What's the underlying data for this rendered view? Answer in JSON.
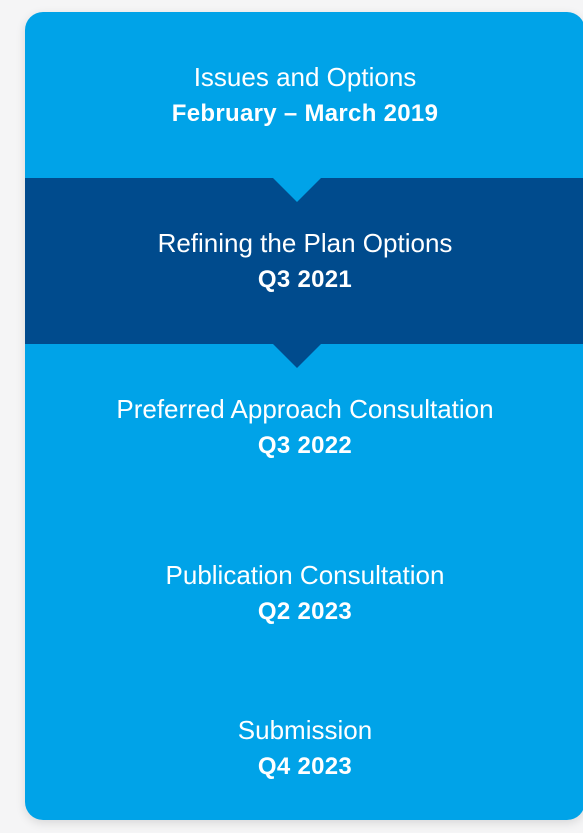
{
  "colors": {
    "primary": "#00a3e8",
    "highlight": "#004b8d",
    "page_background": "#f5f5f6",
    "text": "#ffffff"
  },
  "stages": [
    {
      "label": "Issues and Options",
      "date": "February – March 2019",
      "active": false
    },
    {
      "label": "Refining the Plan Options",
      "date": "Q3 2021",
      "active": true
    },
    {
      "label": "Preferred Approach Consultation",
      "date": "Q3 2022",
      "active": false
    },
    {
      "label": "Publication Consultation",
      "date": "Q2 2023",
      "active": false
    },
    {
      "label": "Submission",
      "date": "Q4 2023",
      "active": false
    }
  ]
}
